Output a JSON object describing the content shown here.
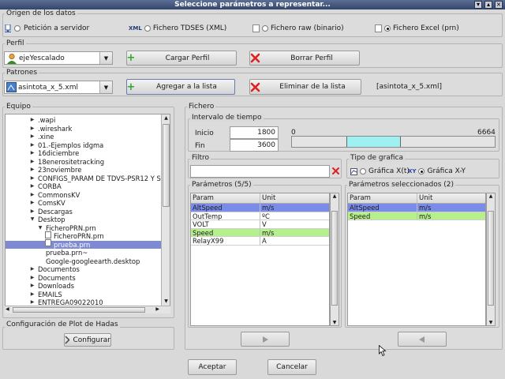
{
  "window": {
    "title": "Seleccione parámetros a representar..."
  },
  "origen": {
    "label": "Origen de los datos",
    "options": [
      {
        "label": "Petición a servidor",
        "selected": false
      },
      {
        "label": "Fichero TDSES (XML)",
        "selected": false
      },
      {
        "label": "Fichero raw (binario)",
        "selected": false
      },
      {
        "label": "Fichero Excel (prn)",
        "selected": true
      }
    ],
    "xml_icon": "XML"
  },
  "perfil": {
    "label": "Perfil",
    "selected": "ejeYescalado",
    "load_label": "Cargar Perfil",
    "delete_label": "Borrar Perfil"
  },
  "patrones": {
    "label": "Patrones",
    "selected": "asintota_x_5.xml",
    "add_label": "Agregar a la lista",
    "remove_label": "Eliminar de la lista",
    "list_value": "[asintota_x_5.xml]"
  },
  "equipo": {
    "label": "Equipo",
    "nodes": [
      {
        "label": ".wapi",
        "level": 1,
        "expander": "right"
      },
      {
        "label": ".wireshark",
        "level": 1,
        "expander": "right"
      },
      {
        "label": ".xine",
        "level": 1,
        "expander": "right"
      },
      {
        "label": "01.-Ejemplos idgma",
        "level": 1,
        "expander": "right"
      },
      {
        "label": "16diciembre",
        "level": 1,
        "expander": "right"
      },
      {
        "label": "18enerositetracking",
        "level": 1,
        "expander": "right"
      },
      {
        "label": "23noviembre",
        "level": 1,
        "expander": "right"
      },
      {
        "label": "CONFIGS_PARAM DE TDVS-PSR12 Y S",
        "level": 1,
        "expander": "right"
      },
      {
        "label": "CORBA",
        "level": 1,
        "expander": "right"
      },
      {
        "label": "CommonsKV",
        "level": 1,
        "expander": "right"
      },
      {
        "label": "ComsKV",
        "level": 1,
        "expander": "right"
      },
      {
        "label": "Descargas",
        "level": 1,
        "expander": "right"
      },
      {
        "label": "Desktop",
        "level": 1,
        "expander": "down"
      },
      {
        "label": "FicheroPRN.prn",
        "level": 2,
        "expander": "down"
      },
      {
        "label": "FicheroPRN.prn",
        "level": 3,
        "expander": "file"
      },
      {
        "label": "prueba.prn",
        "level": 3,
        "expander": "file",
        "selected": true
      },
      {
        "label": "prueba.prn~",
        "level": 2,
        "expander": "none"
      },
      {
        "label": "Google-googleearth.desktop",
        "level": 2,
        "expander": "none"
      },
      {
        "label": "Documentos",
        "level": 1,
        "expander": "right"
      },
      {
        "label": "Documents",
        "level": 1,
        "expander": "right"
      },
      {
        "label": "Downloads",
        "level": 1,
        "expander": "right"
      },
      {
        "label": "EMAILS",
        "level": 1,
        "expander": "right"
      },
      {
        "label": "ENTREGA09022010",
        "level": 1,
        "expander": "right"
      }
    ]
  },
  "plot": {
    "label": "Configuración de Plot de Hadas",
    "configure_label": "Configurar"
  },
  "fichero": {
    "label": "Fichero",
    "interval": {
      "label": "Intervalo de tiempo",
      "start_label": "Inicio",
      "start_value": "1800",
      "end_label": "Fin",
      "end_value": "3600",
      "scale_min": "0",
      "scale_max": "6664",
      "range_start": 1800,
      "range_end": 3600,
      "range_total": 6664
    },
    "filter": {
      "label": "Filtro",
      "value": ""
    },
    "chart_type": {
      "label": "Tipo de grafica",
      "options": [
        {
          "label": "Gráfica X(t)",
          "selected": false
        },
        {
          "label": "Gráfica X-Y",
          "selected": true
        }
      ],
      "xy_icon": "XY"
    },
    "params": {
      "label": "Parámetros (5/5)",
      "col_param": "Param",
      "col_unit": "Unit",
      "rows": [
        {
          "param": "AltSpeed",
          "unit": "m/s",
          "state": "selected"
        },
        {
          "param": "OutTemp",
          "unit": "ºC",
          "state": ""
        },
        {
          "param": "VOLT",
          "unit": "V",
          "state": ""
        },
        {
          "param": "Speed",
          "unit": "m/s",
          "state": "highlight"
        },
        {
          "param": "RelayX99",
          "unit": "A",
          "state": ""
        }
      ]
    },
    "selected_params": {
      "label": "Parámetros seleccionados (2)",
      "col_param": "Param",
      "col_unit": "Unit",
      "rows": [
        {
          "param": "AltSpeed",
          "unit": "m/s",
          "state": "selected"
        },
        {
          "param": "Speed",
          "unit": "m/s",
          "state": "highlight"
        }
      ]
    }
  },
  "actions": {
    "accept_label": "Aceptar",
    "cancel_label": "Cancelar"
  },
  "colors": {
    "title_bg": "#3c4e74",
    "selection": "#7b8bea",
    "highlight": "#b6f08c",
    "range_fill": "#9ff0f3",
    "tree_selection": "#7e8bd4",
    "red_x": "#e02020",
    "green_plus": "#2fa82f"
  }
}
